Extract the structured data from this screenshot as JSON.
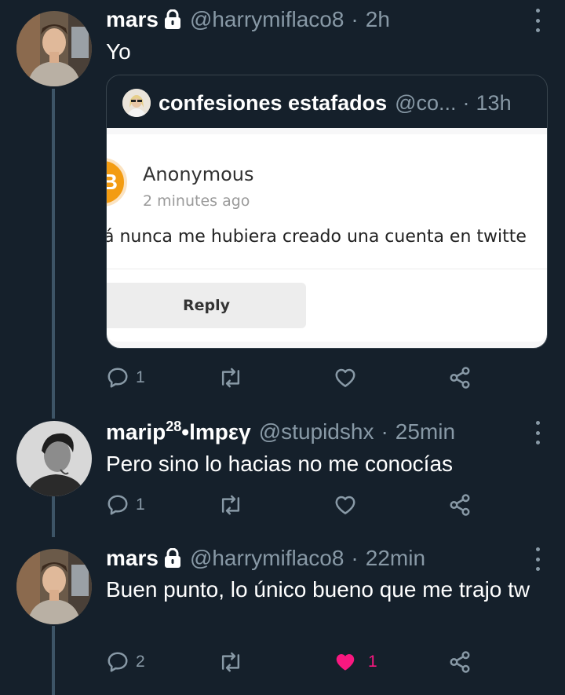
{
  "tweets": [
    {
      "name": "mars",
      "handle": "@harrymiflaco8",
      "time": "2h",
      "text": "Yo",
      "actions": {
        "replies": "1",
        "retweets": "",
        "likes": ""
      },
      "quote": {
        "name": "confesiones estafados",
        "handle": "@co...",
        "time": "13h",
        "card": {
          "author": "Anonymous",
          "time": "2 minutes ago",
          "message": "á nunca me hubiera creado una cuenta en twitte",
          "reply_label": "Reply",
          "avatar_letter": "B"
        }
      }
    },
    {
      "name": "marip",
      "name_sup": "28",
      "name_suffix": "•lmpεγ",
      "handle": "@stupidshx",
      "time": "25min",
      "text": "Pero sino lo hacias no me conocías",
      "actions": {
        "replies": "1",
        "retweets": "",
        "likes": ""
      }
    },
    {
      "name": "mars",
      "handle": "@harrymiflaco8",
      "time": "22min",
      "text": "Buen punto, lo único bueno que me trajo tw",
      "actions": {
        "replies": "2",
        "retweets": "",
        "likes": "1"
      }
    }
  ],
  "colors": {
    "background": "#15202b",
    "secondary_text": "#8899a6",
    "like": "#f91880",
    "thread_line": "#3d5466"
  },
  "icons": [
    "lock-icon",
    "more-icon",
    "reply-icon",
    "retweet-icon",
    "like-icon",
    "share-icon"
  ]
}
